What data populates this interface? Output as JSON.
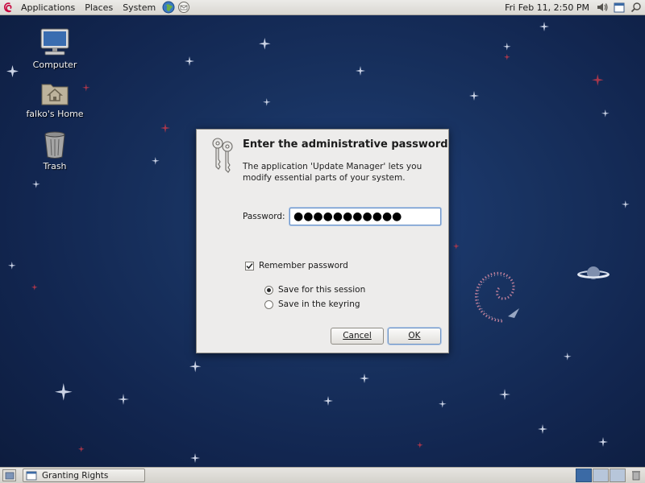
{
  "top_panel": {
    "menus": [
      "Applications",
      "Places",
      "System"
    ],
    "clock": "Fri Feb 11,  2:50 PM"
  },
  "desktop": {
    "icons": [
      {
        "label": "Computer",
        "icon": "computer-icon"
      },
      {
        "label": "falko's Home",
        "icon": "home-folder-icon"
      },
      {
        "label": "Trash",
        "icon": "trash-icon"
      }
    ]
  },
  "dialog": {
    "title": "Enter the administrative password",
    "message": "The application 'Update Manager' lets you modify essential parts of your system.",
    "password_label": "Password:",
    "password_value": "●●●●●●●●●●●",
    "remember_label": "Remember password",
    "remember_checked": true,
    "options": [
      {
        "label": "Save for this session",
        "selected": true
      },
      {
        "label": "Save in the keyring",
        "selected": false
      }
    ],
    "cancel_label": "Cancel",
    "ok_label": "OK"
  },
  "bottom_panel": {
    "task_label": "Granting Rights",
    "workspaces": 4,
    "active_workspace": 1
  },
  "colors": {
    "desktop_bg": "#183260",
    "panel_bg": "#dedcd7",
    "dialog_bg": "#edeceb",
    "focus_blue": "#6f96c9"
  }
}
